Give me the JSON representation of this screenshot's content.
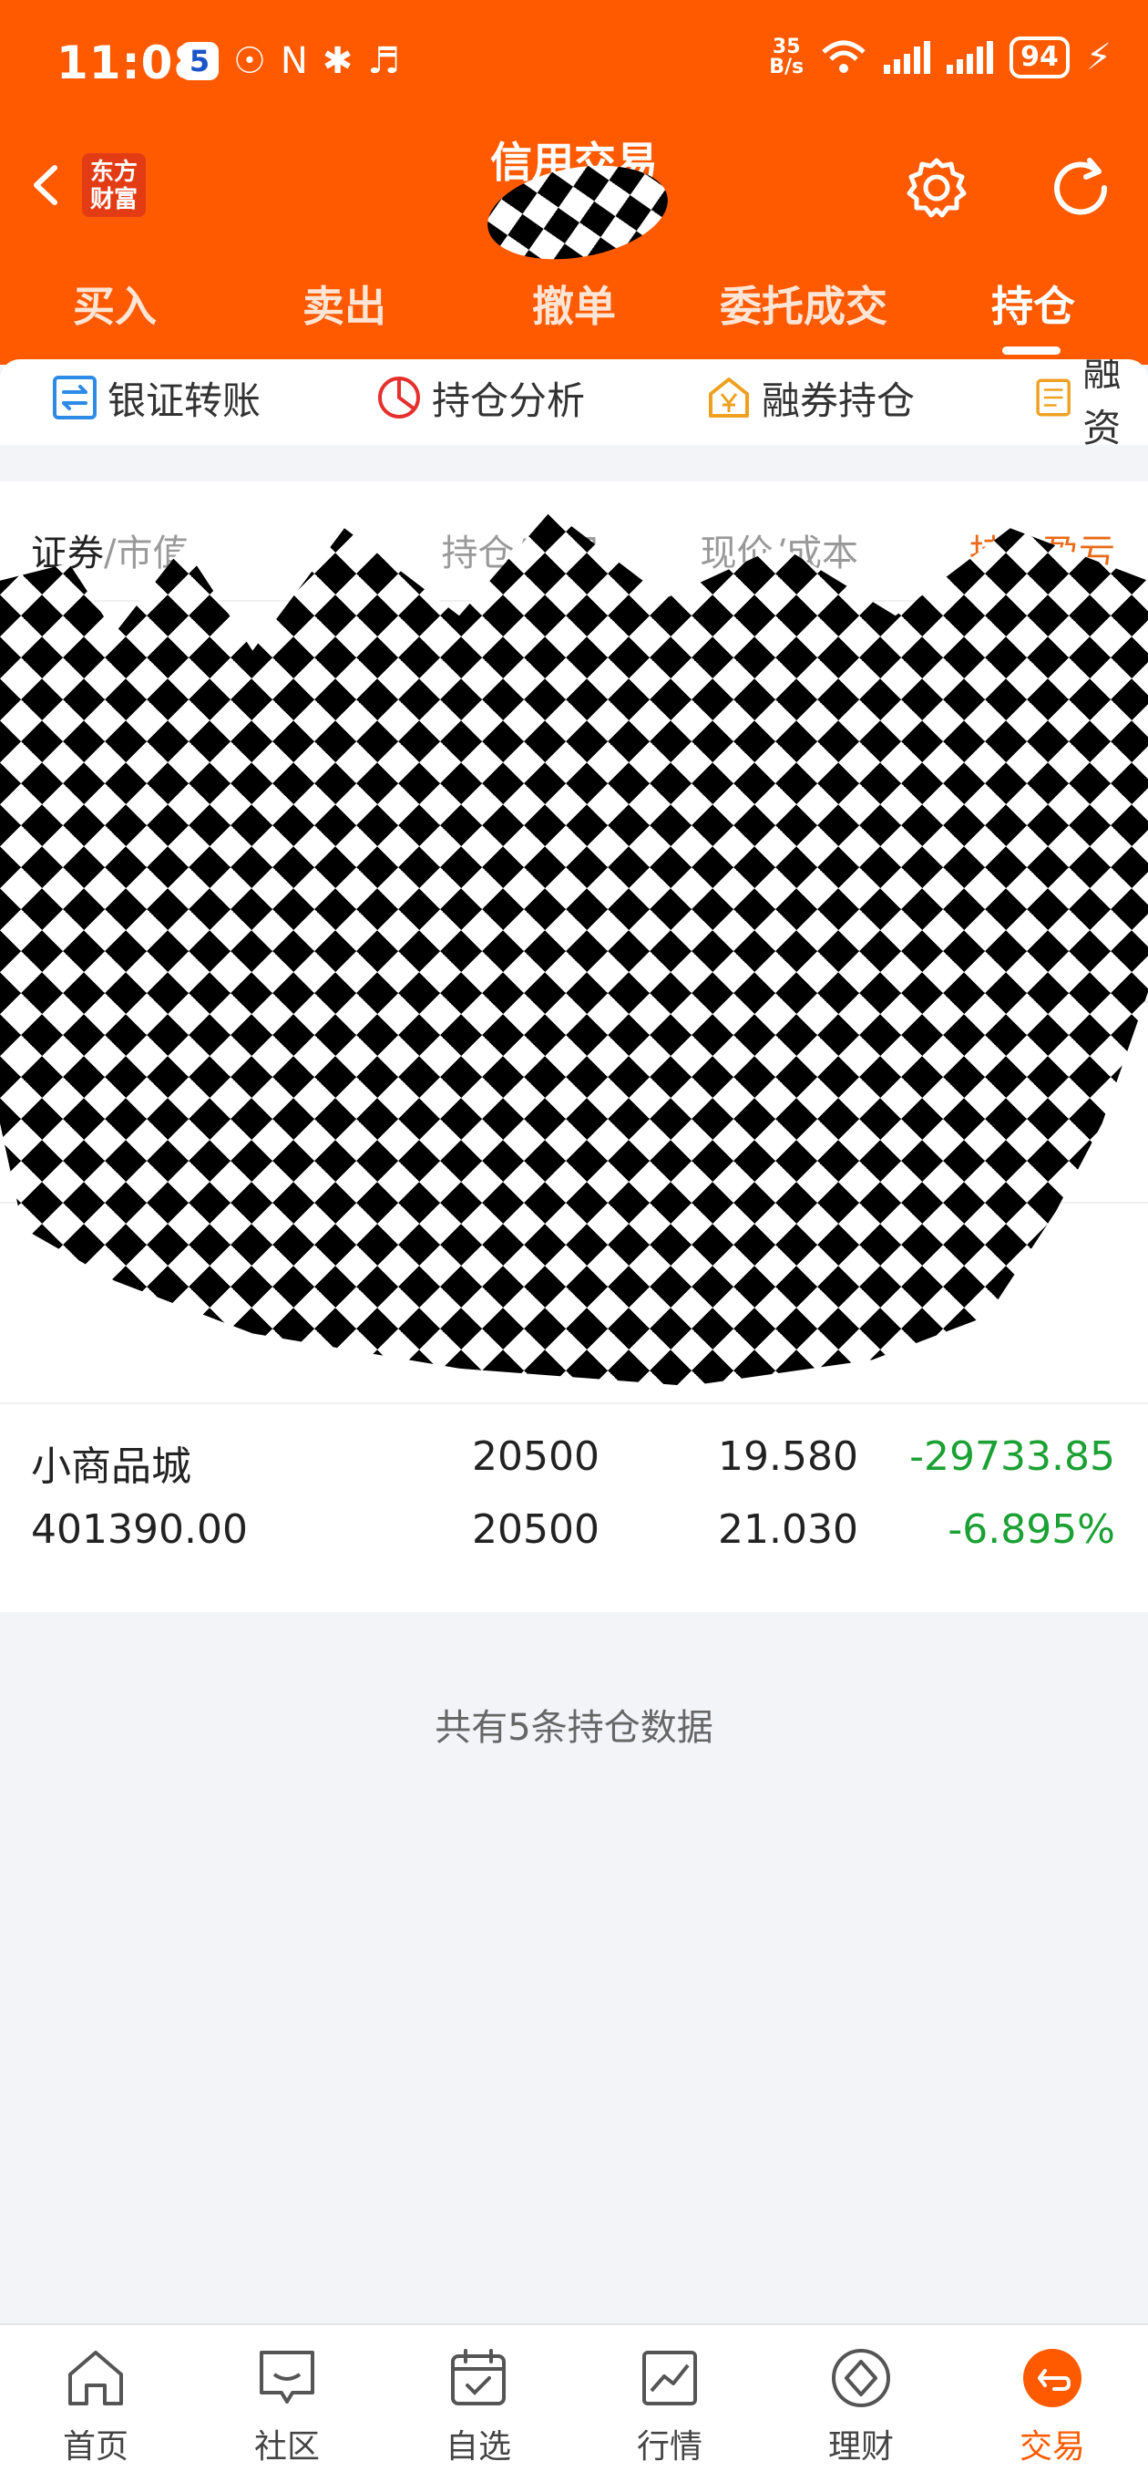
{
  "status_bar": {
    "time": "11:08",
    "app_badge": "5",
    "net_speed_value": "35",
    "net_speed_unit": "B/s",
    "battery": "94"
  },
  "header": {
    "title": "信用交易",
    "logo_line1": "东方",
    "logo_line2": "财富"
  },
  "tabs": [
    {
      "label": "买入"
    },
    {
      "label": "卖出"
    },
    {
      "label": "撤单"
    },
    {
      "label": "委托成交"
    },
    {
      "label": "持仓",
      "active": true
    }
  ],
  "tools": [
    {
      "label": "银证转账",
      "icon": "transfer-icon"
    },
    {
      "label": "持仓分析",
      "icon": "pie-chart-icon"
    },
    {
      "label": "融券持仓",
      "icon": "yen-house-icon"
    },
    {
      "label": "融资",
      "icon": "document-icon"
    }
  ],
  "table": {
    "headers": {
      "security_strong": "证券",
      "security_rest": "/市值",
      "holding": "持仓/可用",
      "price": "现价/成本",
      "pnl": "持仓盈亏"
    },
    "rows": [
      {
        "name": "小商品城",
        "market_value": "401390.00",
        "holding": "20500",
        "available": "20500",
        "price": "19.580",
        "cost": "21.030",
        "pnl": "-29733.85",
        "pnl_pct": "-6.895%"
      }
    ]
  },
  "footer_note": "共有5条持仓数据",
  "colors": {
    "brand": "#ff5a00",
    "loss": "#1aa033",
    "sort_active": "#ea6a17"
  },
  "bottom_nav": [
    {
      "label": "首页",
      "icon": "home-icon"
    },
    {
      "label": "社区",
      "icon": "chat-icon"
    },
    {
      "label": "自选",
      "icon": "calendar-check-icon"
    },
    {
      "label": "行情",
      "icon": "trend-chart-icon"
    },
    {
      "label": "理财",
      "icon": "diamond-icon"
    },
    {
      "label": "交易",
      "icon": "trade-icon",
      "active": true
    }
  ]
}
